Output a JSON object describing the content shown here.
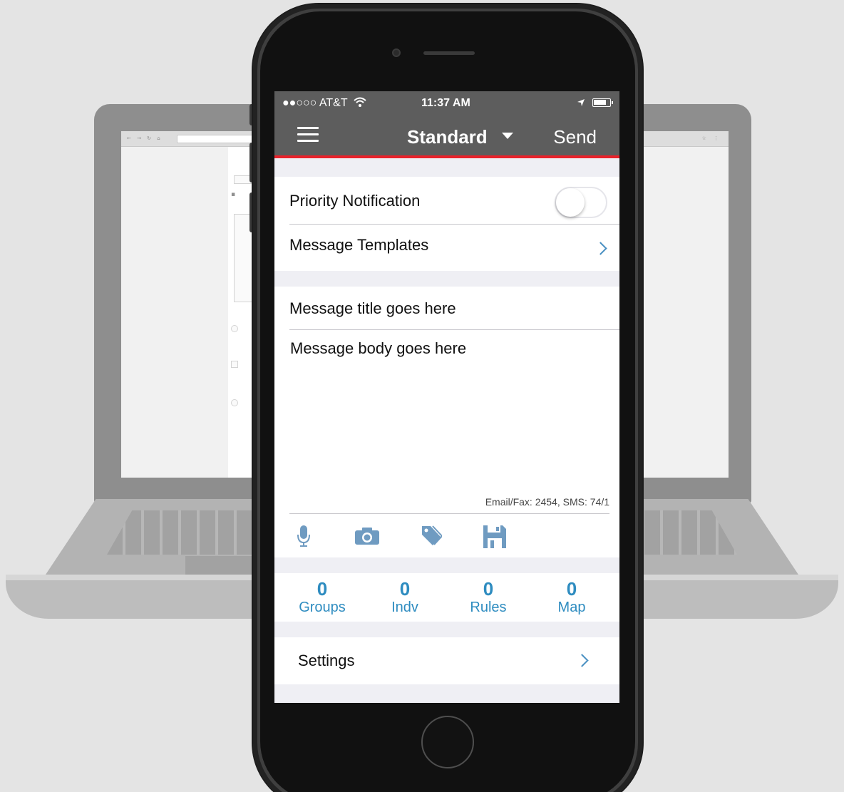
{
  "status_bar": {
    "carrier": "●●○○○ AT&T",
    "time": "11:37 AM"
  },
  "nav_bar": {
    "title": "Standard",
    "send_label": "Send"
  },
  "priority": {
    "label": "Priority Notification",
    "enabled": false
  },
  "templates": {
    "label": "Message Templates"
  },
  "message": {
    "title_placeholder": "Message title goes here",
    "body_placeholder": "Message body goes here",
    "char_count": "Email/Fax: 2454, SMS: 74/1"
  },
  "toolbar_icons": [
    "microphone-icon",
    "camera-icon",
    "tag-icon",
    "save-icon"
  ],
  "recipients": [
    {
      "count": "0",
      "label": "Groups"
    },
    {
      "count": "0",
      "label": "Indv"
    },
    {
      "count": "0",
      "label": "Rules"
    },
    {
      "count": "0",
      "label": "Map"
    }
  ],
  "settings": {
    "label": "Settings"
  },
  "colors": {
    "header": "#5d5d5d",
    "accent_red": "#e8222b",
    "link_blue": "#2e8cc0",
    "icon_blue": "#6f9bc1",
    "screen_background": "#efeff4"
  }
}
